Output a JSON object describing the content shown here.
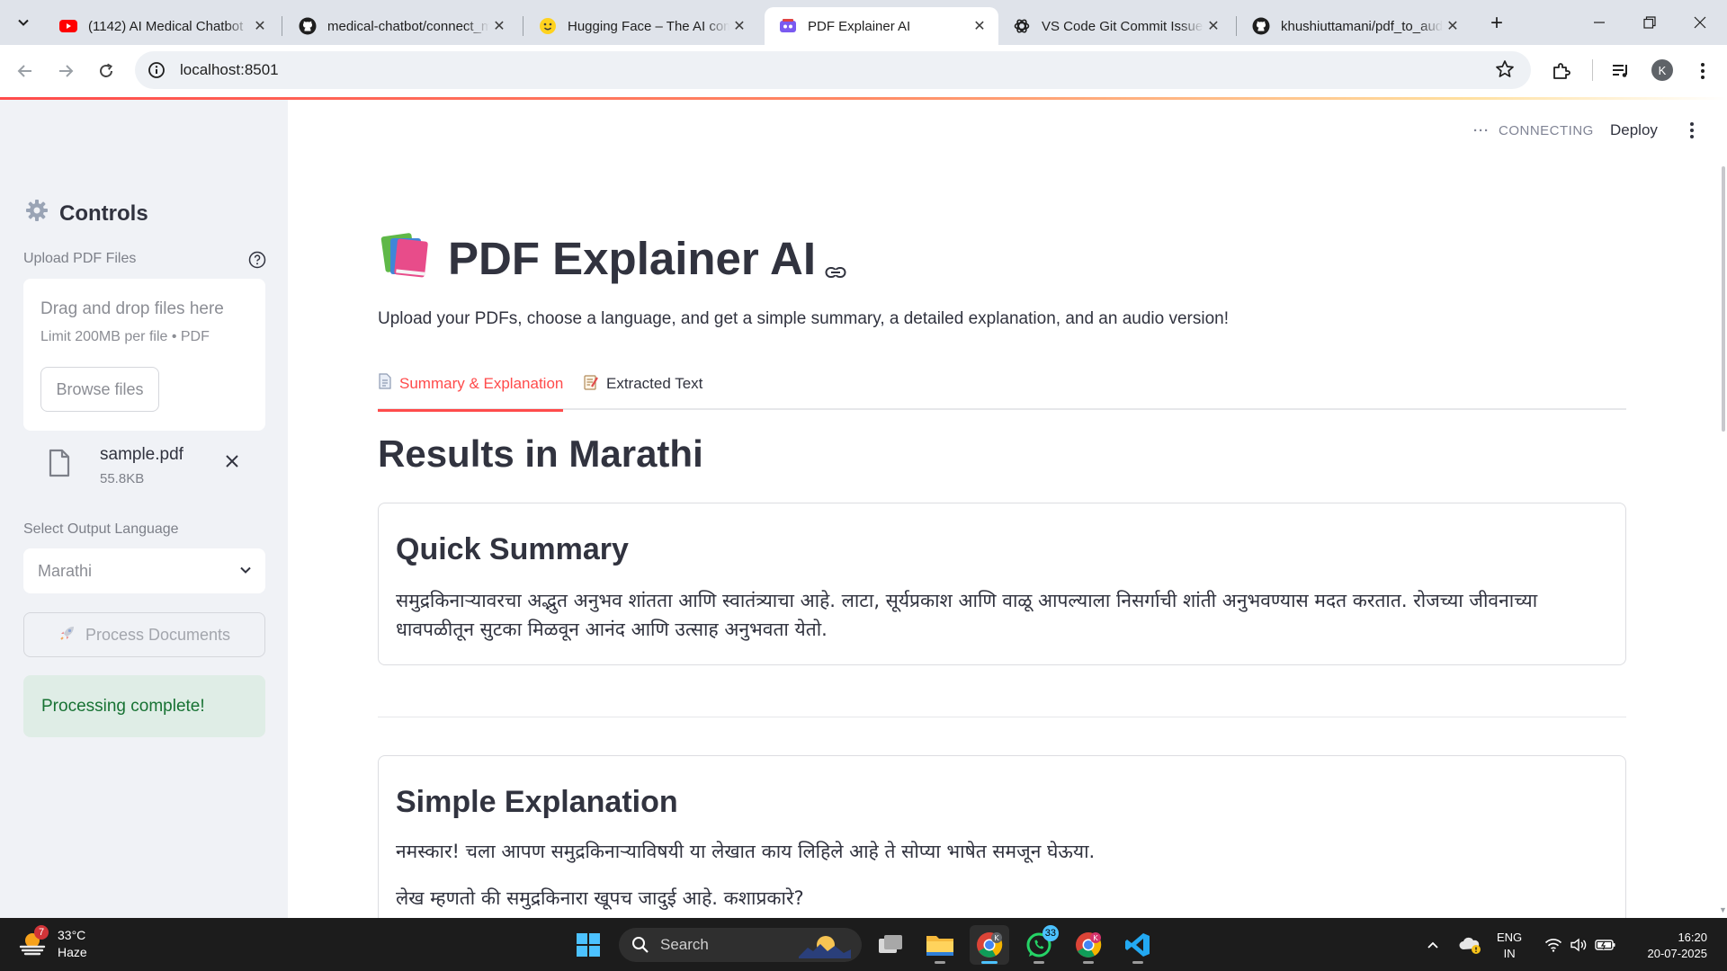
{
  "browser": {
    "tabs": [
      {
        "title": "(1142) AI Medical Chatbot",
        "icon": "youtube-icon"
      },
      {
        "title": "medical-chatbot/connect_memory",
        "icon": "github-icon"
      },
      {
        "title": "Hugging Face – The AI community",
        "icon": "huggingface-icon"
      },
      {
        "title": "PDF Explainer AI",
        "icon": "streamlit-icon",
        "active": true
      },
      {
        "title": "VS Code Git Commit Issue",
        "icon": "openai-icon"
      },
      {
        "title": "khushiuttamani/pdf_to_audio",
        "icon": "github-icon"
      }
    ],
    "url": "localhost:8501",
    "profile_initial": "K"
  },
  "app": {
    "status": "CONNECTING",
    "deploy_label": "Deploy",
    "sidebar": {
      "title": "Controls",
      "upload_label": "Upload PDF Files",
      "dropzone_text": "Drag and drop files here",
      "dropzone_limit": "Limit 200MB per file • PDF",
      "browse_label": "Browse files",
      "file": {
        "name": "sample.pdf",
        "size": "55.8KB"
      },
      "language_label": "Select Output Language",
      "language_value": "Marathi",
      "process_label": "Process Documents",
      "success_message": "Processing complete!"
    },
    "main": {
      "title": "PDF Explainer AI",
      "intro": "Upload your PDFs, choose a language, and get a simple summary, a detailed explanation, and an audio version!",
      "tabs": [
        {
          "label": "Summary & Explanation",
          "active": true
        },
        {
          "label": "Extracted Text",
          "active": false
        }
      ],
      "results_heading": "Results in Marathi",
      "summary": {
        "title": "Quick Summary",
        "text": "समुद्रकिनाऱ्यावरचा अद्भुत अनुभव शांतता आणि स्वातंत्र्याचा आहे. लाटा, सूर्यप्रकाश आणि वाळू आपल्याला निसर्गाची शांती अनुभवण्यास मदत करतात. रोजच्या जीवनाच्या धावपळीतून सुटका मिळवून आनंद आणि उत्साह अनुभवता येतो."
      },
      "explanation": {
        "title": "Simple Explanation",
        "paragraphs": [
          "नमस्कार! चला आपण समुद्रकिनाऱ्याविषयी या लेखात काय लिहिले आहे ते सोप्या भाषेत समजून घेऊया.",
          "लेख म्हणतो की समुद्रकिनारा खूपच जादुई आहे. कशाप्रकारे?"
        ]
      }
    }
  },
  "taskbar": {
    "weather": {
      "temp": "33°C",
      "condition": "Haze",
      "badge": "7"
    },
    "search_placeholder": "Search",
    "whatsapp_badge": "33",
    "lang_line1": "ENG",
    "lang_line2": "IN",
    "time": "16:20",
    "date": "20-07-2025"
  },
  "colors": {
    "accent": "#ff4b4b",
    "sidebar_bg": "#f0f2f6",
    "success_bg": "#dfede6",
    "success_text": "#177233"
  }
}
